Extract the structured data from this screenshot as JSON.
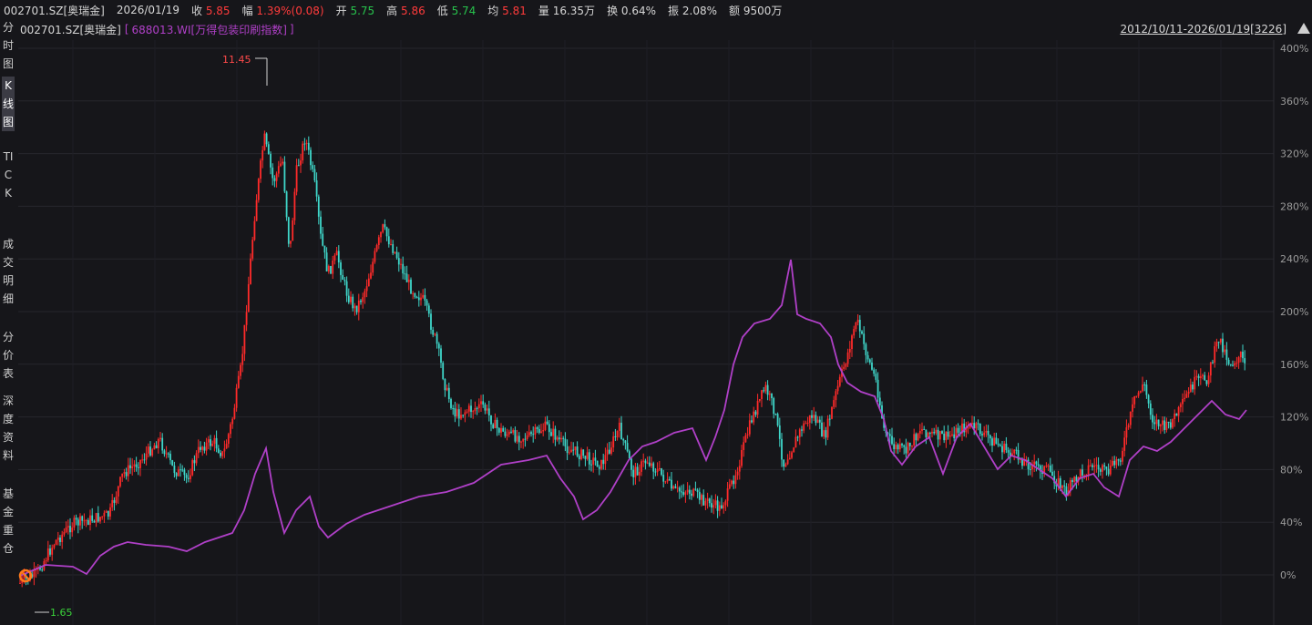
{
  "topbar": {
    "code": "002701.SZ[奥瑞金]",
    "date": "2026/01/19",
    "close_label": "收",
    "close_value": "5.85",
    "change_label": "幅",
    "change_value": "1.39%(0.08)",
    "open_label": "开",
    "open_value": "5.75",
    "high_label": "高",
    "high_value": "5.86",
    "low_label": "低",
    "low_value": "5.74",
    "avg_label": "均",
    "avg_value": "5.81",
    "amount_label": "量",
    "amount_value": "16.35万",
    "turnover_label": "换",
    "turnover_value": "0.64%",
    "amplitude_label": "振",
    "amplitude_value": "2.08%",
    "volume_label": "额",
    "volume_value": "9500万"
  },
  "subbar": {
    "main_series": "002701.SZ[奥瑞金]",
    "bracket_open": "[",
    "compare_series": "688013.WI[万得包装印刷指数]",
    "bracket_close": "]",
    "date_range": "2012/10/11-2026/01/19[3226]"
  },
  "sidebar": {
    "items": [
      {
        "label": "分时图"
      },
      {
        "label": "K线图"
      },
      {
        "label": "TICK"
      },
      {
        "label": "成交明细"
      },
      {
        "label": "分价表"
      },
      {
        "label": "深度资料"
      },
      {
        "label": "基金重仓"
      }
    ]
  },
  "axis": {
    "right_labels": [
      "400%",
      "360%",
      "320%",
      "280%",
      "240%",
      "200%",
      "160%",
      "120%",
      "80%",
      "40%",
      "0%"
    ]
  },
  "markers": {
    "high": "11.45",
    "low": "1.65"
  },
  "colors": {
    "background": "#16161a",
    "grid": "#26262c",
    "up": "#ff2a2a",
    "down": "#3fd6c9",
    "index_line": "#b040c8",
    "high_label": "#ff4a4a",
    "low_label": "#3ad13a"
  }
}
